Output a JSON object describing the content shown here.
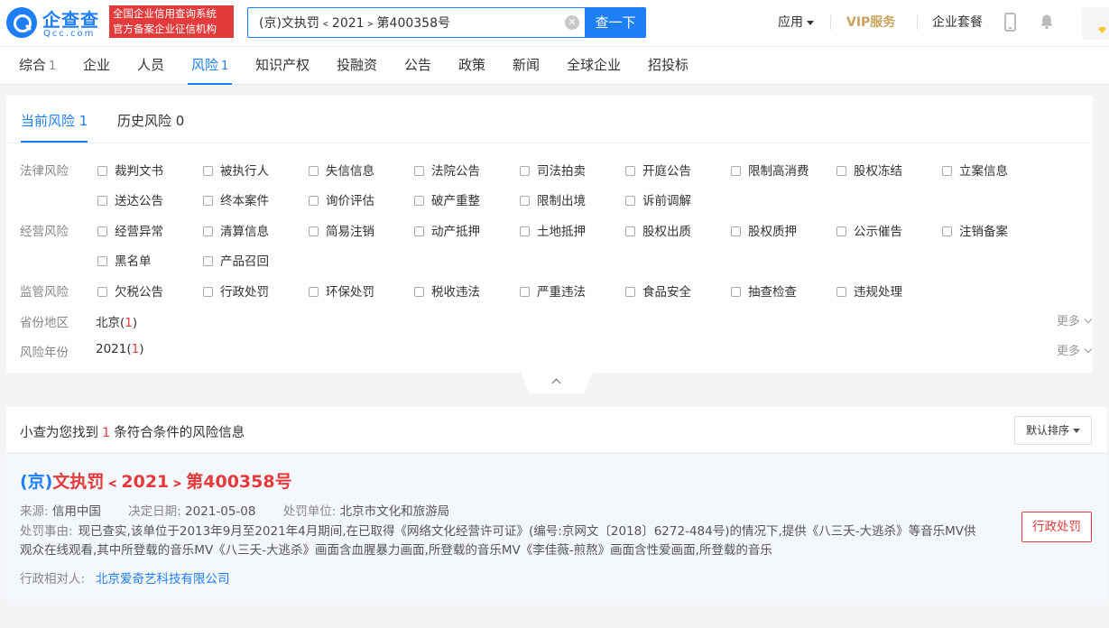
{
  "header": {
    "logo_cn": "企查查",
    "logo_en": "Qcc.com",
    "slogan_line1": "全国企业信用查询系统",
    "slogan_line2": "官方备案企业征信机构",
    "search_value": "(京)文执罚﹤2021﹥第400358号",
    "search_button": "查一下",
    "apps_label": "应用",
    "vip_label": "VIP服务",
    "package_label": "企业套餐",
    "icons": [
      "phone-icon",
      "bell-icon",
      "crown-icon"
    ]
  },
  "categories": [
    {
      "label": "综合",
      "count": "1"
    },
    {
      "label": "企业",
      "count": ""
    },
    {
      "label": "人员",
      "count": ""
    },
    {
      "label": "风险",
      "count": "1"
    },
    {
      "label": "知识产权",
      "count": ""
    },
    {
      "label": "投融资",
      "count": ""
    },
    {
      "label": "公告",
      "count": ""
    },
    {
      "label": "政策",
      "count": ""
    },
    {
      "label": "新闻",
      "count": ""
    },
    {
      "label": "全球企业",
      "count": ""
    },
    {
      "label": "招投标",
      "count": ""
    }
  ],
  "active_category": "风险",
  "tabs": [
    {
      "label": "当前风险 1",
      "active": true
    },
    {
      "label": "历史风险 0",
      "active": false
    }
  ],
  "filters": {
    "legal": {
      "label": "法律风险",
      "options": [
        "裁判文书",
        "被执行人",
        "失信信息",
        "法院公告",
        "司法拍卖",
        "开庭公告",
        "限制高消费",
        "股权冻结",
        "立案信息",
        "送达公告",
        "终本案件",
        "询价评估",
        "破产重整",
        "限制出境",
        "诉前调解"
      ]
    },
    "business": {
      "label": "经营风险",
      "options": [
        "经营异常",
        "清算信息",
        "简易注销",
        "动产抵押",
        "土地抵押",
        "股权出质",
        "股权质押",
        "公示催告",
        "注销备案",
        "黑名单",
        "产品召回"
      ]
    },
    "regulatory": {
      "label": "监管风险",
      "options": [
        "欠税公告",
        "行政处罚",
        "环保处罚",
        "税收违法",
        "严重违法",
        "食品安全",
        "抽查检查",
        "违规处理"
      ]
    },
    "province": {
      "label": "省份地区",
      "value": "北京",
      "count": "1",
      "more": "更多"
    },
    "year": {
      "label": "风险年份",
      "value": "2021",
      "count": "1",
      "more": "更多"
    }
  },
  "results": {
    "summary_prefix": "小查为您找到",
    "summary_count": "1",
    "summary_suffix": "条符合条件的风险信息",
    "sort_label": "默认排序",
    "item": {
      "title_paren": "(京)",
      "title_rest": "文执罚﹤2021﹥第400358号",
      "source_key": "来源:",
      "source_val": "信用中国",
      "date_key": "决定日期:",
      "date_val": "2021-05-08",
      "org_key": "处罚单位:",
      "org_val": "北京市文化和旅游局",
      "reason_key": "处罚事由:",
      "reason_val": "现已查实,该单位于2013年9月至2021年4月期间,在已取得《网络文化经营许可证》(编号:京网文〔2018〕6272-484号)的情况下,提供《八三夭-大逃杀》等音乐MV供观众在线观看,其中所登载的音乐MV《八三夭-大逃杀》画面含血腥暴力画面,所登载的音乐MV《李佳薇-煎熬》画面含性爱画面,所登载的音乐",
      "party_key": "行政相对人:",
      "party_val": "北京爱奇艺科技有限公司",
      "tag": "行政处罚"
    }
  },
  "colors": {
    "accent": "#1e7ef5",
    "danger": "#e33b3b",
    "vip": "#c9a15b"
  }
}
